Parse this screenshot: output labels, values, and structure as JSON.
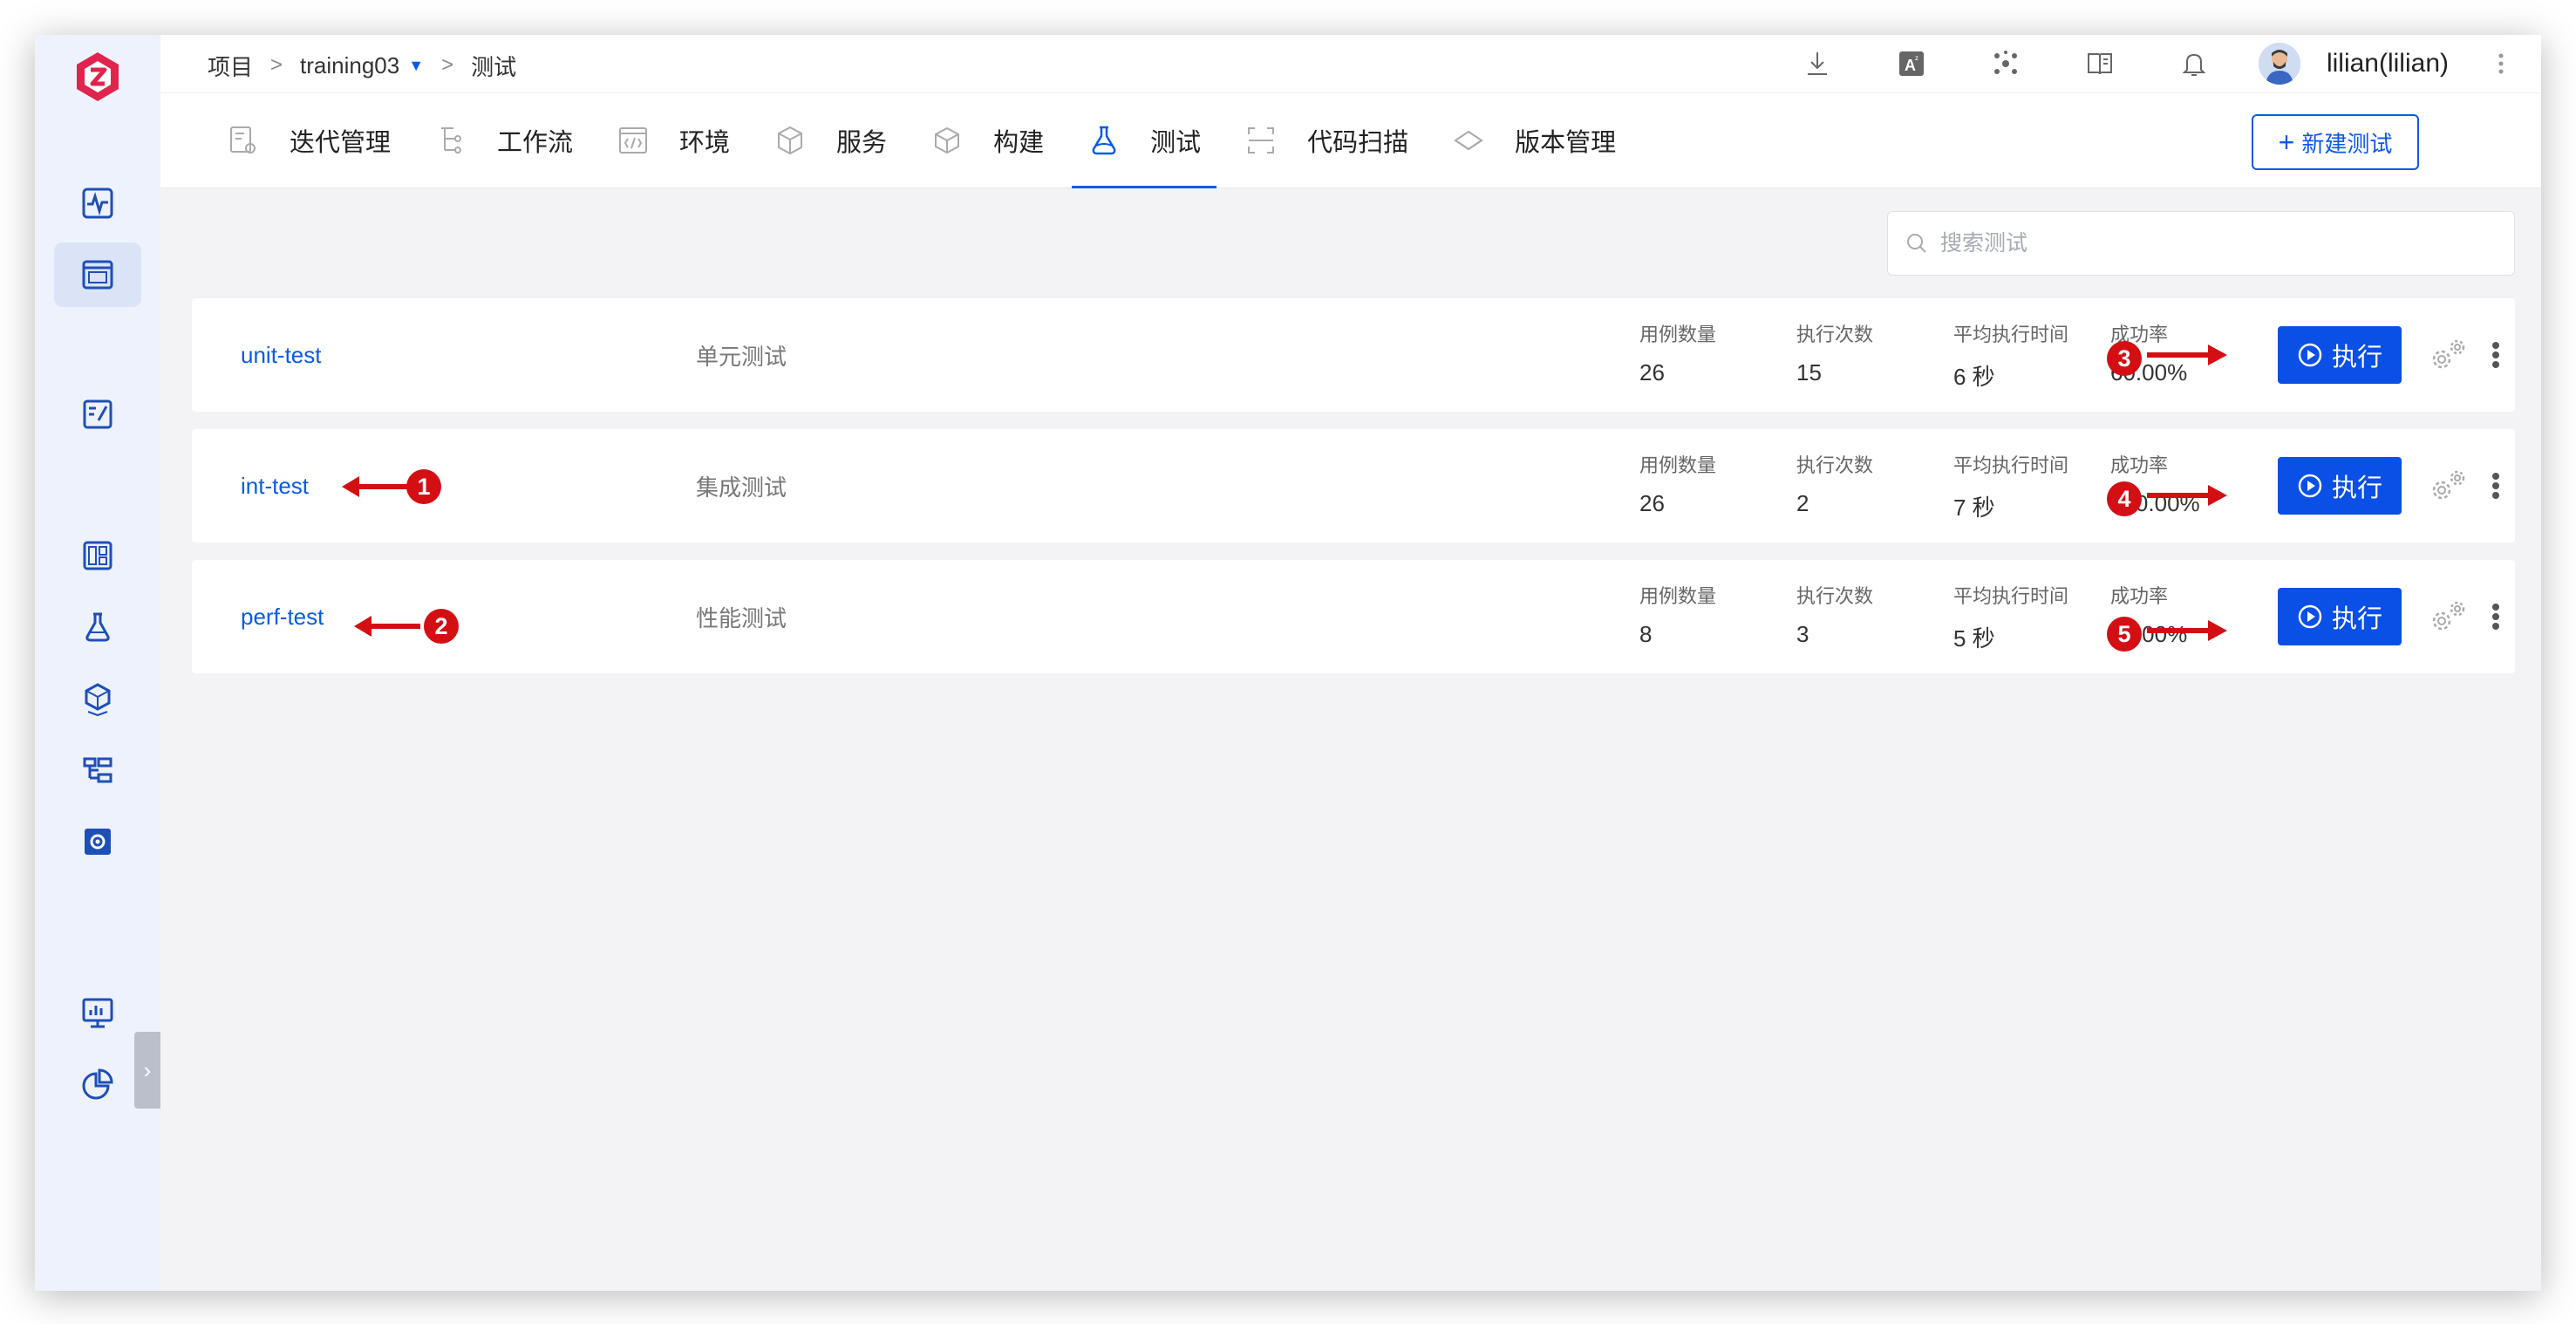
{
  "breadcrumb": {
    "root": "项目",
    "project": "training03",
    "current": "测试",
    "sep": ">"
  },
  "user": {
    "name": "lilian(lilian)"
  },
  "tabs": [
    {
      "label": "迭代管理",
      "icon": "iteration-icon"
    },
    {
      "label": "工作流",
      "icon": "workflow-icon"
    },
    {
      "label": "环境",
      "icon": "environment-icon"
    },
    {
      "label": "服务",
      "icon": "service-icon"
    },
    {
      "label": "构建",
      "icon": "build-icon"
    },
    {
      "label": "测试",
      "icon": "flask-icon",
      "active": true
    },
    {
      "label": "代码扫描",
      "icon": "scan-icon"
    },
    {
      "label": "版本管理",
      "icon": "version-icon"
    }
  ],
  "new_test_button": "新建测试",
  "search": {
    "placeholder": "搜索测试"
  },
  "stat_labels": {
    "cases": "用例数量",
    "runs": "执行次数",
    "avg_time": "平均执行时间",
    "success": "成功率"
  },
  "run_label": "执行",
  "tests": [
    {
      "name": "unit-test",
      "desc": "单元测试",
      "cases": "26",
      "runs": "15",
      "avg_time": "6 秒",
      "success": "60.00%"
    },
    {
      "name": "int-test",
      "desc": "集成测试",
      "cases": "26",
      "runs": "2",
      "avg_time": "7 秒",
      "success": "100.00%"
    },
    {
      "name": "perf-test",
      "desc": "性能测试",
      "cases": "8",
      "runs": "3",
      "avg_time": "5 秒",
      "success": "33.00%"
    }
  ],
  "annotations": [
    "1",
    "2",
    "3",
    "4",
    "5"
  ],
  "colors": {
    "accent": "#0a5ae6",
    "button": "#0a4fe6",
    "annotation": "#d30f14",
    "logo": "#e0244e"
  },
  "rail_icons": [
    "logo-icon",
    "activity-icon",
    "project-icon",
    "edit-doc-icon",
    "dashboard-icon",
    "test-flask-icon",
    "artifact-icon",
    "release-icon",
    "settings-box-icon",
    "monitor-chart-icon",
    "pie-chart-icon"
  ]
}
